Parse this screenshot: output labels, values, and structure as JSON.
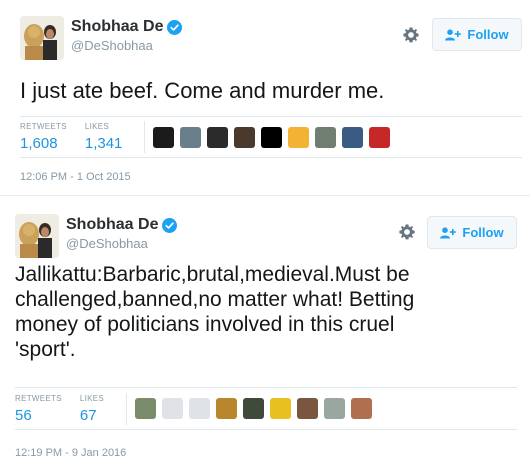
{
  "tweets": [
    {
      "display_name": "Shobhaa De",
      "handle": "@DeShobhaa",
      "follow_label": "Follow",
      "text": "I just ate beef. Come and murder me.",
      "retweets_label": "RETWEETS",
      "retweets": "1,608",
      "likes_label": "LIKES",
      "likes": "1,341",
      "timestamp": "12:06 PM - 1 Oct 2015",
      "likers": [
        "#1b1b1b",
        "#6a7f8c",
        "#2b2b2b",
        "#4a3a2e",
        "#000000",
        "#f2b233",
        "#6f7e70",
        "#3a5b82",
        "#c62828"
      ]
    },
    {
      "display_name": "Shobhaa De",
      "handle": "@DeShobhaa",
      "follow_label": "Follow",
      "text_lines": [
        "Jallikattu:Barbaric,brutal,medieval.Must be",
        "challenged,banned,no matter what! Betting",
        "money of politicians involved in this cruel",
        "'sport'."
      ],
      "retweets_label": "RETWEETS",
      "retweets": "56",
      "likes_label": "LIKES",
      "likes": "67",
      "timestamp": "12:19 PM - 9 Jan 2016",
      "likers": [
        "#7a8b6a",
        "#dfe3e8",
        "#dfe3e8",
        "#b8862d",
        "#3f4a3a",
        "#e8c020",
        "#7a5540",
        "#9aa6a0",
        "#b07050"
      ]
    }
  ],
  "colors": {
    "link_blue": "#1b95e0",
    "verified_blue": "#1da1f2",
    "muted": "#8899a6"
  }
}
